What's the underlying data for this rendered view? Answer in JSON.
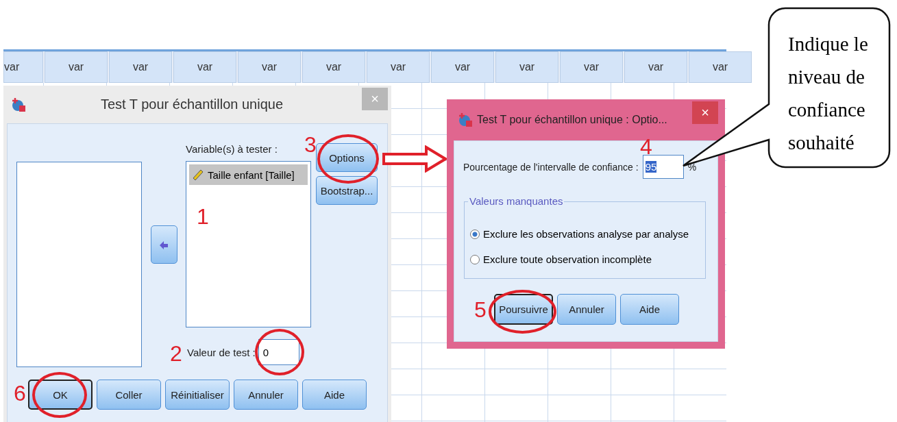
{
  "spreadsheet": {
    "column_headers": [
      "var",
      "var",
      "var",
      "var",
      "var",
      "var",
      "var",
      "var",
      "var",
      "var",
      "var",
      "var"
    ]
  },
  "main_dialog": {
    "title": "Test T pour échantillon unique",
    "close": "×",
    "target_label": "Variable(s) à tester :",
    "target_variables": [
      {
        "label": "Taille enfant [Taille]",
        "selected": true
      }
    ],
    "side_buttons": [
      {
        "label": "Options",
        "focused": false
      },
      {
        "label": "Bootstrap...",
        "focused": false
      }
    ],
    "test_value": {
      "label": "Valeur de test :",
      "value": "0"
    },
    "buttons": [
      {
        "label": "OK",
        "focused": true
      },
      {
        "label": "Coller",
        "focused": false
      },
      {
        "label": "Réinitialiser",
        "focused": false
      },
      {
        "label": "Annuler",
        "focused": false
      },
      {
        "label": "Aide",
        "focused": false
      }
    ]
  },
  "options_dialog": {
    "title": "Test T pour échantillon unique : Optio...",
    "close": "×",
    "confidence": {
      "label": "Pourcentage de l'intervalle de confiance :",
      "value": "95",
      "unit": "%"
    },
    "missing_values": {
      "legend": "Valeurs manquantes",
      "options": [
        {
          "label": "Exclure les observations analyse par analyse",
          "selected": true
        },
        {
          "label": "Exclure toute observation incomplète",
          "selected": false
        }
      ]
    },
    "buttons": [
      {
        "label": "Poursuivre",
        "focused": true
      },
      {
        "label": "Annuler",
        "focused": false
      },
      {
        "label": "Aide",
        "focused": false
      }
    ]
  },
  "annotations": {
    "step_numbers": [
      "1",
      "2",
      "3",
      "4",
      "5",
      "6"
    ],
    "callout": "Indique le\nniveau de\nconfiance\nsouhaité"
  }
}
